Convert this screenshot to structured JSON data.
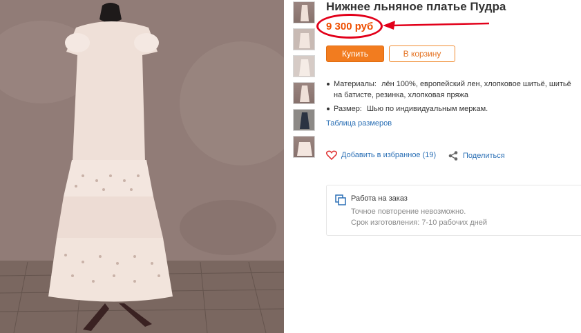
{
  "product": {
    "title": "Нижнее льняное платье Пудра",
    "price": "9 300 руб"
  },
  "buttons": {
    "buy": "Купить",
    "cart": "В корзину"
  },
  "details": [
    {
      "label": "Материалы:",
      "value": "лён 100%, европейский лен, хлопковое шитьё, шитьё на батисте, резинка, хлопковая пряжа"
    },
    {
      "label": "Размер:",
      "value": "Шью по индивидуальным меркам."
    }
  ],
  "links": {
    "sizes": "Таблица размеров",
    "favorite": "Добавить в избранное (19)",
    "share": "Поделиться"
  },
  "order_card": {
    "title": "Работа на заказ",
    "line1": "Точное повторение невозможно.",
    "line2": "Срок изготовления: 7-10 рабочих дней"
  },
  "colors": {
    "price": "#ee4e00",
    "buy_button": "#f27c1f",
    "link": "#2a6fb5",
    "annotation": "#e2001a"
  },
  "thumbnails_count": 6
}
